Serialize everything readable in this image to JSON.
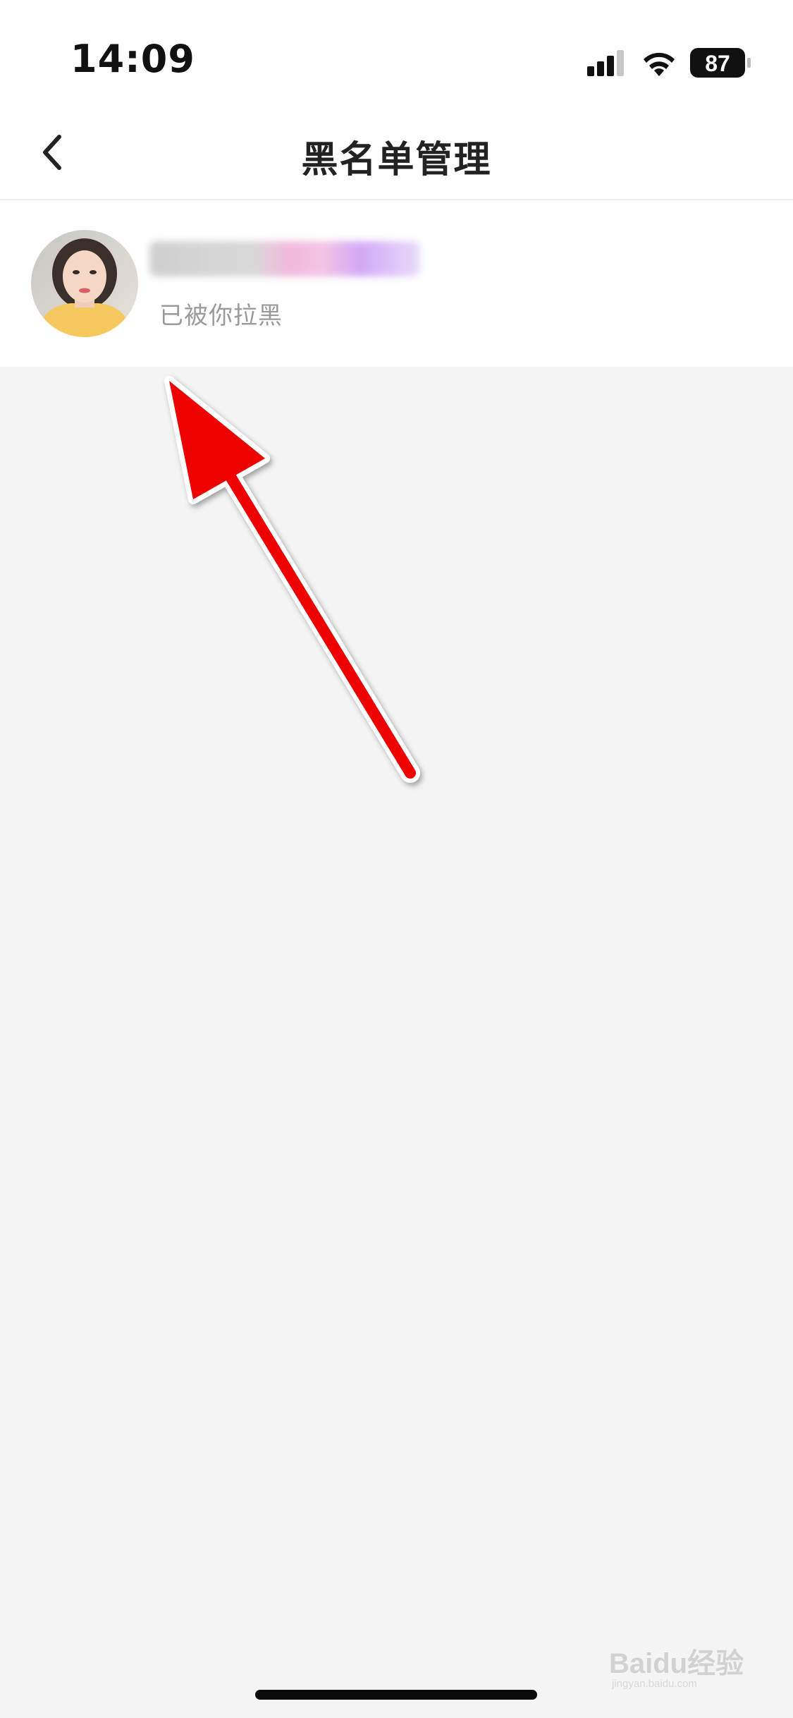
{
  "status_bar": {
    "time": "14:09",
    "battery_level": "87",
    "icons": [
      "signal-icon",
      "wifi-icon",
      "battery-icon"
    ]
  },
  "nav": {
    "title": "黑名单管理",
    "back_icon": "chevron-left-icon"
  },
  "blocked_list": [
    {
      "name": "",
      "status": "已被你拉黑"
    }
  ],
  "colors": {
    "page_background": "#f4f4f4",
    "card_background": "#ffffff",
    "annotation_arrow": "#ee0000"
  },
  "watermark": {
    "text": "Baidu经验",
    "sub_text": "jingyan.baidu.com"
  }
}
